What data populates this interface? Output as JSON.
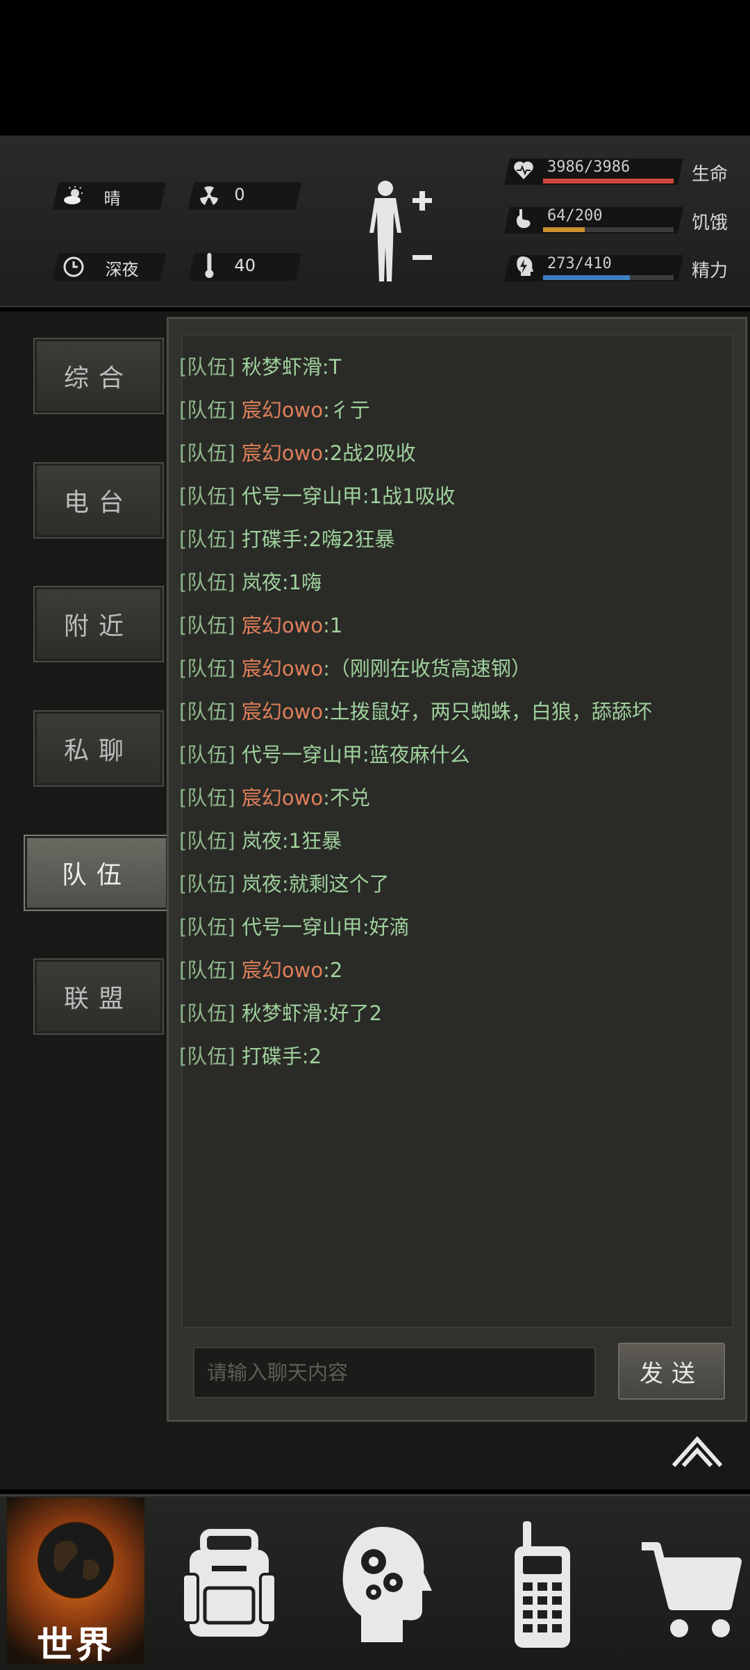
{
  "status": {
    "weather": "晴",
    "radiation": "0",
    "time_of_day": "深夜",
    "temperature": "40",
    "stats": [
      {
        "name": "health",
        "value": "3986/3986",
        "label": "生命",
        "fill": 1.0,
        "color": "#d04a3c"
      },
      {
        "name": "hunger",
        "value": "64/200",
        "label": "饥饿",
        "fill": 0.32,
        "color": "#c9922e"
      },
      {
        "name": "energy",
        "value": "273/410",
        "label": "精力",
        "fill": 0.666,
        "color": "#3d7fc4"
      }
    ]
  },
  "sidebar": {
    "tabs": [
      {
        "key": "general",
        "label": "综合",
        "active": false
      },
      {
        "key": "radio",
        "label": "电台",
        "active": false
      },
      {
        "key": "nearby",
        "label": "附近",
        "active": false
      },
      {
        "key": "private",
        "label": "私聊",
        "active": false
      },
      {
        "key": "team",
        "label": "队伍",
        "active": true
      },
      {
        "key": "alliance",
        "label": "联盟",
        "active": false
      }
    ]
  },
  "chat": {
    "messages": [
      {
        "channel": "[队伍]",
        "name": "秋梦虾滑",
        "text": ":T",
        "name_color": "green"
      },
      {
        "channel": "[队伍]",
        "name": "宸幻owo",
        "text": ":彳亍",
        "name_color": "orange"
      },
      {
        "channel": "[队伍]",
        "name": "宸幻owo",
        "text": ":2战2吸收",
        "name_color": "orange"
      },
      {
        "channel": "[队伍]",
        "name": "代号一穿山甲",
        "text": ":1战1吸收",
        "name_color": "green"
      },
      {
        "channel": "[队伍]",
        "name": "打碟手",
        "text": ":2嗨2狂暴",
        "name_color": "green"
      },
      {
        "channel": "[队伍]",
        "name": "岚夜",
        "text": ":1嗨",
        "name_color": "green"
      },
      {
        "channel": "[队伍]",
        "name": "宸幻owo",
        "text": ":1",
        "name_color": "orange"
      },
      {
        "channel": "[队伍]",
        "name": "宸幻owo",
        "text": ":（刚刚在收货高速钢）",
        "name_color": "orange"
      },
      {
        "channel": "[队伍]",
        "name": "宸幻owo",
        "text": ":土拨鼠好，两只蜘蛛，白狼，舔舔坏",
        "name_color": "orange"
      },
      {
        "channel": "[队伍]",
        "name": "代号一穿山甲",
        "text": ":蓝夜麻什么",
        "name_color": "green"
      },
      {
        "channel": "[队伍]",
        "name": "宸幻owo",
        "text": ":不兑",
        "name_color": "orange"
      },
      {
        "channel": "[队伍]",
        "name": "岚夜",
        "text": ":1狂暴",
        "name_color": "green"
      },
      {
        "channel": "[队伍]",
        "name": "岚夜",
        "text": ":就剩这个了",
        "name_color": "green"
      },
      {
        "channel": "[队伍]",
        "name": "代号一穿山甲",
        "text": ":好滴",
        "name_color": "green"
      },
      {
        "channel": "[队伍]",
        "name": "宸幻owo",
        "text": ":2",
        "name_color": "orange"
      },
      {
        "channel": "[队伍]",
        "name": "秋梦虾滑",
        "text": ":好了2",
        "name_color": "green"
      },
      {
        "channel": "[队伍]",
        "name": "打碟手",
        "text": ":2",
        "name_color": "green"
      }
    ],
    "input_placeholder": "请输入聊天内容",
    "send_label": "发送"
  },
  "bottom_nav": {
    "world_label": "世界",
    "items": [
      {
        "key": "world",
        "icon": "globe-icon",
        "active": true
      },
      {
        "key": "backpack",
        "icon": "backpack-icon",
        "active": false
      },
      {
        "key": "skills",
        "icon": "head-gears-icon",
        "active": false
      },
      {
        "key": "radio",
        "icon": "walkie-talkie-icon",
        "active": false
      },
      {
        "key": "shop",
        "icon": "shopping-cart-icon",
        "active": false
      }
    ]
  }
}
